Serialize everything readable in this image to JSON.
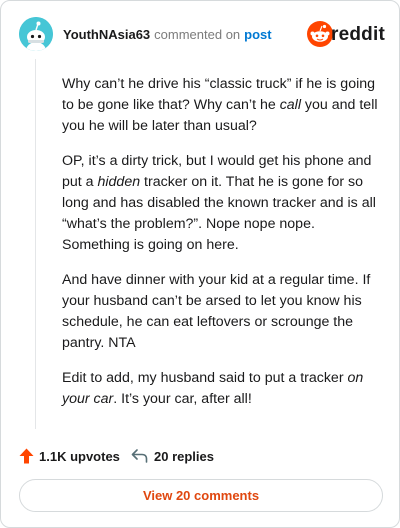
{
  "header": {
    "username": "YouthNAsia63",
    "commented_on": "commented on",
    "post_link": "post",
    "brand": "reddit"
  },
  "comment": {
    "paragraphs": [
      {
        "segments": [
          {
            "text": "Why can’t he drive his “classic truck” if he is going to be gone like that? Why can’t he ",
            "italic": false
          },
          {
            "text": "call",
            "italic": true
          },
          {
            "text": " you and tell you he will be later than usual?",
            "italic": false
          }
        ]
      },
      {
        "segments": [
          {
            "text": "OP, it’s a dirty trick, but I would get his phone and put a ",
            "italic": false
          },
          {
            "text": "hidden",
            "italic": true
          },
          {
            "text": " tracker on it. That he is gone for so long and has disabled the known tracker and is all “what’s the problem?”. Nope nope nope. Something is going on here.",
            "italic": false
          }
        ]
      },
      {
        "segments": [
          {
            "text": "And have dinner with your kid at a regular time. If your husband can’t be arsed to let you know his schedule, he can eat leftovers or scrounge the pantry. NTA",
            "italic": false
          }
        ]
      },
      {
        "segments": [
          {
            "text": "Edit to add, my husband said to put a tracker ",
            "italic": false
          },
          {
            "text": "on your car",
            "italic": true
          },
          {
            "text": ". It’s your car, after all!",
            "italic": false
          }
        ]
      }
    ]
  },
  "actions": {
    "upvotes": "1.1K upvotes",
    "replies": "20 replies"
  },
  "footer": {
    "view_comments": "View 20 comments"
  },
  "colors": {
    "upvote": "#ff4500",
    "link": "#0079d3",
    "view_button_text": "#e0470f",
    "avatar_bg": "#46c6d6"
  },
  "icons": {
    "avatar": "snoo-avatar-icon",
    "logo": "reddit-logo-icon",
    "upvote": "upvote-arrow-icon",
    "reply": "reply-arrow-icon"
  }
}
